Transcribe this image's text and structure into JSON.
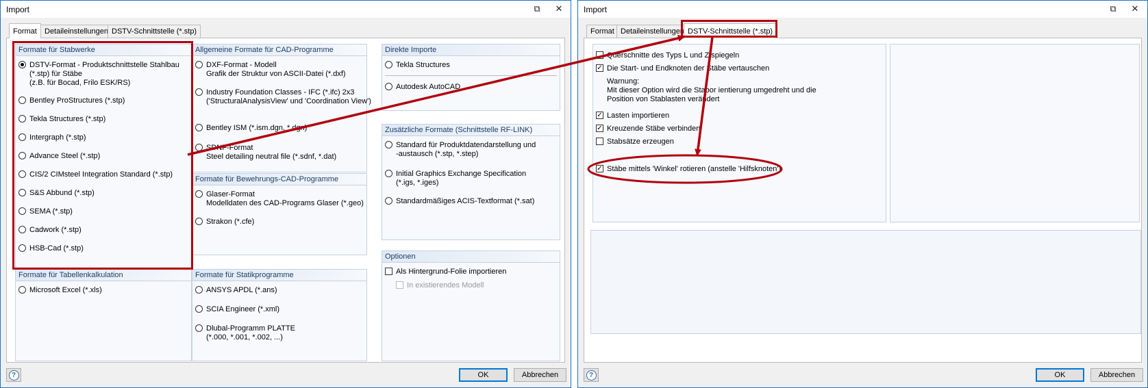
{
  "left_dialog": {
    "title": "Import",
    "tabs": [
      "Format",
      "Detaileinstellungen",
      "DSTV-Schnittstelle (*.stp)"
    ],
    "active_tab": 0,
    "groups": {
      "stabwerke": {
        "title": "Formate für Stabwerke",
        "options": [
          {
            "lines": [
              "DSTV-Format - Produktschnittstelle Stahlbau",
              "(*.stp) für Stäbe",
              "(z.B. für Bocad, Frilo ESK/RS)"
            ],
            "selected": true
          },
          {
            "lines": [
              "Bentley ProStructures (*.stp)"
            ],
            "selected": false
          },
          {
            "lines": [
              "Tekla Structures (*.stp)"
            ],
            "selected": false
          },
          {
            "lines": [
              "Intergraph (*.stp)"
            ],
            "selected": false
          },
          {
            "lines": [
              "Advance Steel (*.stp)"
            ],
            "selected": false
          },
          {
            "lines": [
              "CIS/2 CIMsteel Integration Standard (*.stp)"
            ],
            "selected": false
          },
          {
            "lines": [
              "S&S Abbund (*.stp)"
            ],
            "selected": false
          },
          {
            "lines": [
              "SEMA (*.stp)"
            ],
            "selected": false
          },
          {
            "lines": [
              "Cadwork (*.stp)"
            ],
            "selected": false
          },
          {
            "lines": [
              "HSB-Cad (*.stp)"
            ],
            "selected": false
          }
        ]
      },
      "cad": {
        "title": "Allgemeine Formate für CAD-Programme",
        "options": [
          {
            "lines": [
              "DXF-Format - Modell",
              "Grafik der Struktur von ASCII-Datei (*.dxf)"
            ]
          },
          {
            "lines": [
              "Industry Foundation Classes - IFC (*.ifc) 2x3",
              "('StructuralAnalysisView' und 'Coordination View')"
            ]
          },
          {
            "lines": [
              "Bentley ISM (*.ism.dgn, *.dgn)"
            ]
          },
          {
            "lines": [
              "SDNF-Format",
              "Steel detailing neutral file (*.sdnf, *.dat)"
            ]
          }
        ]
      },
      "direkt": {
        "title": "Direkte Importe",
        "options": [
          {
            "lines": [
              "Tekla Structures"
            ]
          },
          {
            "lines": [
              "Autodesk AutoCAD"
            ]
          }
        ]
      },
      "zusatz": {
        "title": "Zusätzliche Formate (Schnittstelle RF-LINK)",
        "options": [
          {
            "lines": [
              "Standard für Produktdatendarstellung und",
              "-austausch (*.stp, *.step)"
            ]
          },
          {
            "lines": [
              "Initial Graphics Exchange Specification",
              "(*.igs, *.iges)"
            ]
          },
          {
            "lines": [
              "Standardmäßiges ACIS-Textformat (*.sat)"
            ]
          }
        ]
      },
      "bewehrung": {
        "title": "Formate für Bewehrungs-CAD-Programme",
        "options": [
          {
            "lines": [
              "Glaser-Format",
              "Modelldaten des CAD-Programs Glaser (*.geo)"
            ]
          },
          {
            "lines": [
              "Strakon (*.cfe)"
            ]
          }
        ]
      },
      "optionen": {
        "title": "Optionen",
        "check1": "Als Hintergrund-Folie importieren",
        "check2": "In existierendes Modell"
      },
      "tabelle": {
        "title": "Formate für Tabellenkalkulation",
        "options": [
          {
            "lines": [
              "Microsoft Excel (*.xls)"
            ]
          }
        ]
      },
      "statik": {
        "title": "Formate für Statikprogramme",
        "options": [
          {
            "lines": [
              "ANSYS APDL (*.ans)"
            ]
          },
          {
            "lines": [
              "SCIA Engineer (*.xml)"
            ]
          },
          {
            "lines": [
              "Dlubal-Programm PLATTE",
              "(*.000, *.001, *.002, ...)"
            ]
          }
        ]
      }
    },
    "ok_label": "OK",
    "cancel_label": "Abbrechen"
  },
  "right_dialog": {
    "title": "Import",
    "tabs": [
      "Format",
      "Detaileinstellungen",
      "DSTV-Schnittstelle (*.stp)"
    ],
    "active_tab": 2,
    "checks": [
      {
        "label": "Querschnitte des Typs L und Z spiegeln",
        "checked": false
      },
      {
        "label": "Die Start- und Endknoten der Stäbe vertauschen",
        "checked": true
      }
    ],
    "warning": [
      "Warnung:",
      "Mit dieser Option wird die Stabor ientierung umgedreht und die",
      "Position von Stablasten verändert"
    ],
    "checks2": [
      {
        "label": "Lasten importieren",
        "checked": true
      },
      {
        "label": "Kreuzende Stäbe verbinden",
        "checked": true
      },
      {
        "label": "Stabsätze erzeugen",
        "checked": false
      }
    ],
    "check_rotate": {
      "label": "Stäbe mittels 'Winkel' rotieren (anstelle 'Hilfsknoten')",
      "checked": true
    },
    "ok_label": "OK",
    "cancel_label": "Abbrechen"
  },
  "colors": {
    "accent": "#0078d7",
    "highlight": "#b1000f",
    "group_title": "#1f3d66"
  }
}
